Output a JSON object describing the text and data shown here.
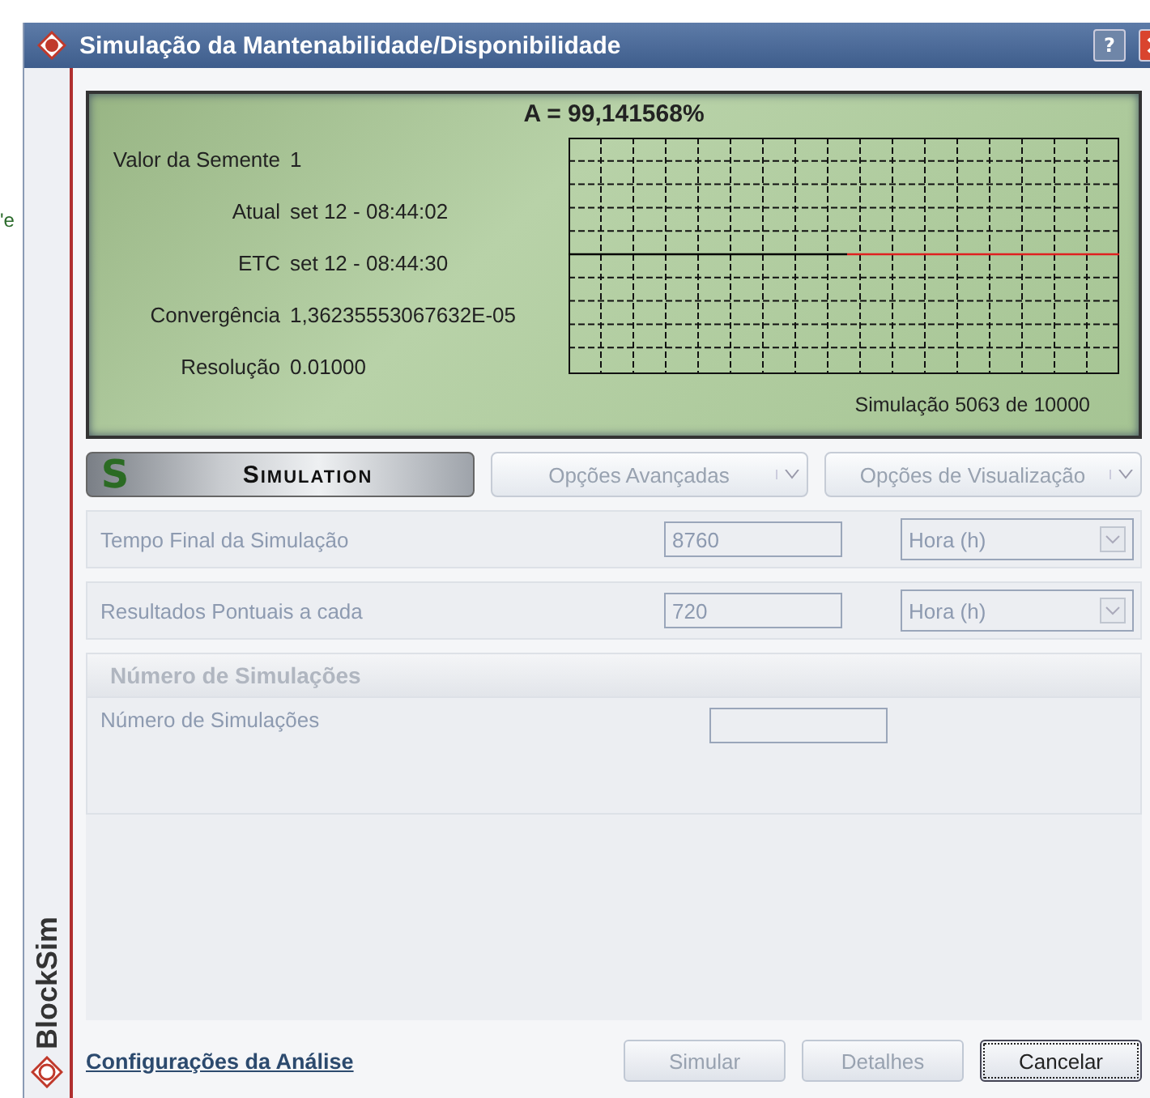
{
  "background_fragment": "'e",
  "window": {
    "title": "Simulação da Mantenabilidade/Disponibilidade",
    "help_button": "?"
  },
  "sidebar": {
    "brand": "BlockSim"
  },
  "status_panel": {
    "headline": "A = 99,141568%",
    "stats": [
      {
        "label": "Valor da Semente",
        "value": "1"
      },
      {
        "label": "Atual",
        "value": "set 12 - 08:44:02"
      },
      {
        "label": "ETC",
        "value": "set 12 - 08:44:30"
      },
      {
        "label": "Convergência",
        "value": "1,36235553067632E-05"
      },
      {
        "label": "Resolução",
        "value": "0.01000"
      }
    ],
    "progress": "Simulação 5063 de 10000"
  },
  "toolbar": {
    "logo_letter": "S",
    "logo_text": "Simulation",
    "menus": [
      {
        "label": "Opções Avançadas",
        "disabled": true
      },
      {
        "label": "Opções de Visualização",
        "disabled": true
      }
    ]
  },
  "settings": [
    {
      "label": "Tempo Final da Simulação",
      "value": "8760",
      "unit": "Hora (h)",
      "disabled": true
    },
    {
      "label": "Resultados Pontuais a cada",
      "value": "720",
      "unit": "Hora (h)",
      "disabled": true
    }
  ],
  "simulations_section": {
    "header": "Número de Simulações",
    "label": "Número de Simulações",
    "disabled": true
  },
  "footer": {
    "link": "Configurações da Análise",
    "buttons": [
      {
        "label": "Simular",
        "disabled": true,
        "focused": false
      },
      {
        "label": "Detalhes",
        "disabled": true,
        "focused": false
      },
      {
        "label": "Cancelar",
        "disabled": false,
        "focused": true
      }
    ]
  }
}
